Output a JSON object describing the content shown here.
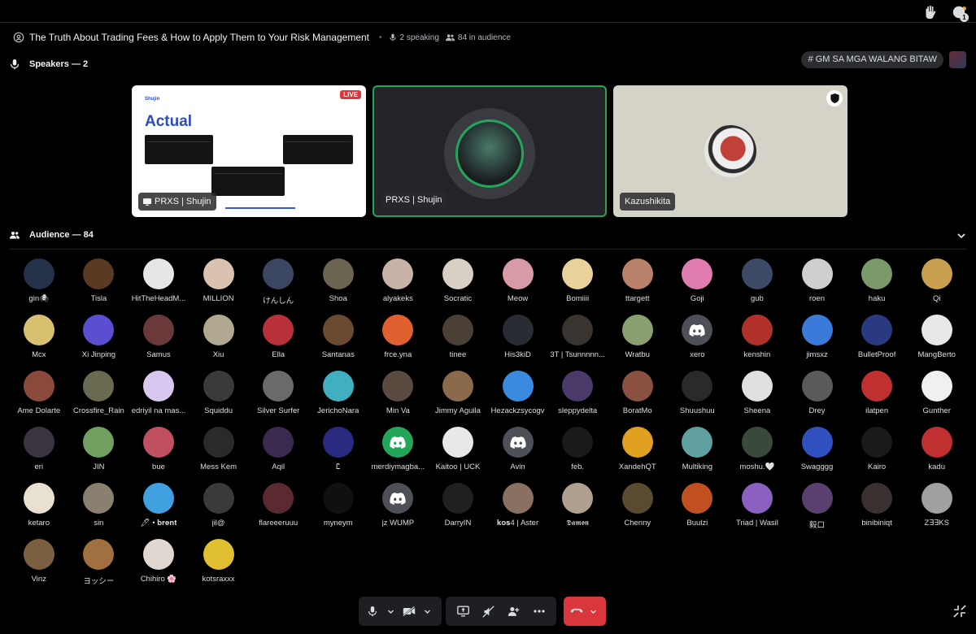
{
  "stage": {
    "title": "The Truth About Trading Fees & How to Apply Them to Your Risk Management",
    "speaking": "2 speaking",
    "audience_count": "84 in audience",
    "notification_count": "1"
  },
  "speakers_label": "Speakers — 2",
  "channel_pill": "# GM SA MGA WALANG BITAW",
  "tiles": {
    "share_name": "PRXS | Shujin",
    "share_logo": "Shujin",
    "share_slide_title": "Actual",
    "live": "LIVE",
    "active_name": "PRXS | Shujin",
    "third_name": "Kazushikita"
  },
  "audience_label": "Audience — 84",
  "audience": [
    {
      "name": "gin🕷",
      "color": "#26324a"
    },
    {
      "name": "Tisla",
      "color": "#5a3a22"
    },
    {
      "name": "HitTheHeadM...",
      "color": "#e6e6e6"
    },
    {
      "name": "MILLION",
      "color": "#d9c2b0"
    },
    {
      "name": "けんしん",
      "color": "#3b4660"
    },
    {
      "name": "Shoa",
      "color": "#6a6450"
    },
    {
      "name": "alyakeks",
      "color": "#c9b2a8"
    },
    {
      "name": "Socratic",
      "color": "#d8cfc5"
    },
    {
      "name": "Meow",
      "color": "#d99aa8"
    },
    {
      "name": "Bomiiii",
      "color": "#e8d19a"
    },
    {
      "name": "ttargett",
      "color": "#b9806a"
    },
    {
      "name": "Goji",
      "color": "#e07cb0"
    },
    {
      "name": "gub",
      "color": "#3c4a66"
    },
    {
      "name": "roen",
      "color": "#cfcfcf"
    },
    {
      "name": "haku",
      "color": "#7a9a6a"
    },
    {
      "name": "Qi",
      "color": "#c9a050"
    },
    {
      "name": "Mcx",
      "color": "#d8c070"
    },
    {
      "name": "Xi Jinping",
      "color": "#5b4ed0"
    },
    {
      "name": "Samus",
      "color": "#6a3a3a"
    },
    {
      "name": "Xiu",
      "color": "#b0a890"
    },
    {
      "name": "Ella",
      "color": "#b8303a"
    },
    {
      "name": "Santanas",
      "color": "#6a4a30"
    },
    {
      "name": "frce.yna",
      "color": "#e06030"
    },
    {
      "name": "tinee",
      "color": "#4a4036"
    },
    {
      "name": "His3kiD",
      "color": "#2a2c34"
    },
    {
      "name": "3T | Tsunnnnn...",
      "color": "#3a3430"
    },
    {
      "name": "Wratbu",
      "color": "#8aa070"
    },
    {
      "name": "xero",
      "color": "#4e5058"
    },
    {
      "name": "kenshin",
      "color": "#b0302a"
    },
    {
      "name": "jimsxz",
      "color": "#3a7ad8"
    },
    {
      "name": "BulletProof",
      "color": "#2a3a80"
    },
    {
      "name": "MangBerto",
      "color": "#e8e8e8"
    },
    {
      "name": "Ame Dolarte",
      "color": "#8a4a3a"
    },
    {
      "name": "Crossfire_Rain",
      "color": "#6a6a50"
    },
    {
      "name": "edriyil na mas...",
      "color": "#d8c8f0"
    },
    {
      "name": "Squiddu",
      "color": "#3a3a3a"
    },
    {
      "name": "Silver Surfer",
      "color": "#6a6a6a"
    },
    {
      "name": "JerichoNara",
      "color": "#40b0c0"
    },
    {
      "name": "Min Va",
      "color": "#5a4a40"
    },
    {
      "name": "Jimmy Aguila",
      "color": "#8a6a4a"
    },
    {
      "name": "Hezackzsycogv",
      "color": "#3a8ae0"
    },
    {
      "name": "sleppydelta",
      "color": "#4a3a6a"
    },
    {
      "name": "BoratMo",
      "color": "#8a5040"
    },
    {
      "name": "Shuushuu",
      "color": "#2a2a2a"
    },
    {
      "name": "Sheena",
      "color": "#e0e0e0"
    },
    {
      "name": "Drey",
      "color": "#5a5a5a"
    },
    {
      "name": "ilatpen",
      "color": "#c03030"
    },
    {
      "name": "Gunther",
      "color": "#f0f0f0"
    },
    {
      "name": "eri",
      "color": "#3a3440"
    },
    {
      "name": "JIN",
      "color": "#70a060"
    },
    {
      "name": "bue",
      "color": "#c05060"
    },
    {
      "name": "Mess Kem",
      "color": "#2a2a2a"
    },
    {
      "name": "Aqil",
      "color": "#3a2a50"
    },
    {
      "name": "Ꮭ",
      "color": "#2a2a80"
    },
    {
      "name": "merdiymagba...",
      "color": "#23a55a"
    },
    {
      "name": "Kaitoo | UCK",
      "color": "#e8e8e8"
    },
    {
      "name": "Avin",
      "color": "#4e5058"
    },
    {
      "name": "feb.",
      "color": "#1a1a1a"
    },
    {
      "name": "XandehQT",
      "color": "#e0a020"
    },
    {
      "name": "Multiking",
      "color": "#60a0a0"
    },
    {
      "name": "moshu.🤍",
      "color": "#3a4a3a"
    },
    {
      "name": "Swagggg",
      "color": "#3050c0"
    },
    {
      "name": "Kairo",
      "color": "#1a1a1a"
    },
    {
      "name": "kadu",
      "color": "#c03030"
    },
    {
      "name": "ketaro",
      "color": "#e8e0d0"
    },
    {
      "name": "sin",
      "color": "#8a8070"
    },
    {
      "name": "🖊 • 𝐛𝐫𝐞𝐧𝐭",
      "color": "#40a0e0"
    },
    {
      "name": "jil@",
      "color": "#3a3a3a"
    },
    {
      "name": "flareeeruuu",
      "color": "#5a2a30"
    },
    {
      "name": "myneym",
      "color": "#101010"
    },
    {
      "name": "jz WUMP",
      "color": "#4e5058"
    },
    {
      "name": "DarryIN",
      "color": "#202020"
    },
    {
      "name": "𝐤𝐨𝐬4 | Aster",
      "color": "#8a7060"
    },
    {
      "name": "𝕯𝖆𝖒𝖔𝖓",
      "color": "#b0a090"
    },
    {
      "name": "Chenny",
      "color": "#5a4a30"
    },
    {
      "name": "Buulzi",
      "color": "#c05020"
    },
    {
      "name": "Triad | Wasil",
      "color": "#8a60c0"
    },
    {
      "name": "毅口",
      "color": "#5a4070"
    },
    {
      "name": "binibiniqt",
      "color": "#3a3030"
    },
    {
      "name": "Z∃∃KS",
      "color": "#a0a0a0"
    },
    {
      "name": "Vinz",
      "color": "#7a6040"
    },
    {
      "name": "ヨッシー",
      "color": "#a07040"
    },
    {
      "name": "Chihiro 🌸",
      "color": "#e0d8d0"
    },
    {
      "name": "kotsraxxx",
      "color": "#e0c030"
    }
  ],
  "colors": {
    "background": "#000000",
    "live_red": "#da373c",
    "speaking_green": "#23a55a",
    "discord_blurple": "#5865f2"
  }
}
